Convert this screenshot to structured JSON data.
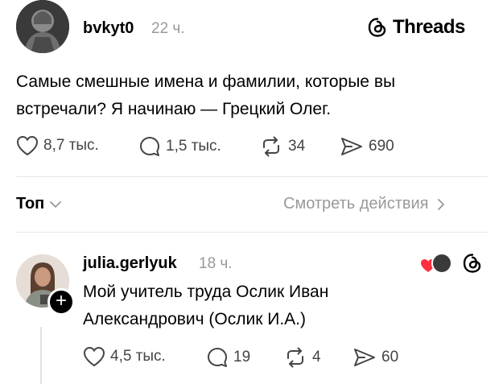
{
  "post": {
    "username": "bvkyt0",
    "time": "22 ч.",
    "brand": "Threads",
    "text_line1": "Самые смешные имена и фамилии, которые вы",
    "text_line2": "встречали? Я начинаю — Грецкий Олег.",
    "likes": "8,7 тыс.",
    "comments": "1,5 тыс.",
    "reposts": "34",
    "shares": "690"
  },
  "sort_bar": {
    "label": "Топ",
    "activity_link": "Смотреть действия"
  },
  "reply": {
    "username": "julia.gerlyuk",
    "time": "18 ч.",
    "text_line1": "Мой учитель труда Ослик Иван",
    "text_line2": "Александрович (Ослик И.А.)",
    "likes": "4,5 тыс.",
    "comments": "19",
    "reposts": "4",
    "shares": "60"
  },
  "colors": {
    "like_heart": "#ff3040",
    "muted_text": "#999999",
    "divider": "#e6e6e6"
  }
}
